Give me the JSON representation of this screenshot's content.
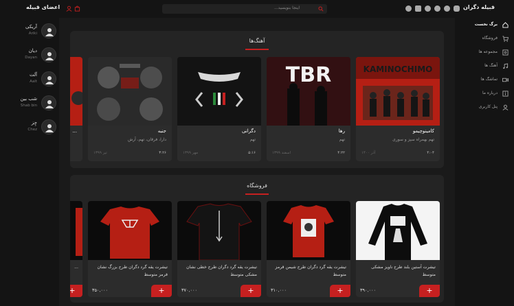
{
  "topbar": {
    "members_title": "اعضای قبیله",
    "search_placeholder": "اینجا بنویسید...",
    "brand": "قبیله دگران"
  },
  "members": [
    {
      "name": "آریکی",
      "sub": "Ariki"
    },
    {
      "name": "دیان",
      "sub": "Dayan"
    },
    {
      "name": "آلت",
      "sub": "Aalt"
    },
    {
      "name": "شب بین",
      "sub": "Shab bin"
    },
    {
      "name": "چِز",
      "sub": "Chez"
    }
  ],
  "nav": [
    {
      "label": "برگ نخست",
      "icon": "home-icon",
      "active": true
    },
    {
      "label": "فروشگاه",
      "icon": "cart-icon"
    },
    {
      "label": "مجموعه ها",
      "icon": "album-icon"
    },
    {
      "label": "آهنگ ها",
      "icon": "music-icon"
    },
    {
      "label": "تماشگ ها",
      "icon": "video-icon"
    },
    {
      "label": "درباره ما",
      "icon": "info-icon"
    },
    {
      "label": "پنل کاربری",
      "icon": "user-icon"
    }
  ],
  "songs_section": {
    "title": "آهنگ‌ها",
    "items": [
      {
        "title": "کامینوچیمو",
        "artist": "تهم بهمراه سپز و سوری",
        "duration": "۴:۰۴",
        "date": "آذر ۱۴۰۰"
      },
      {
        "title": "رها",
        "artist": "تهم",
        "duration": "۴:۲۲",
        "date": "اسفند ۱۳۹۹"
      },
      {
        "title": "دگرانی",
        "artist": "تهم",
        "duration": "۵:۱۶",
        "date": "مهر ۱۳۹۹"
      },
      {
        "title": "جنبه",
        "artist": "دارا، فرقان، تهم، آرش",
        "duration": "۳:۲۶",
        "date": "تیر ۱۳۹۹"
      },
      {
        "title": "...",
        "artist": "",
        "duration": "",
        "date": ""
      }
    ]
  },
  "shop_section": {
    "title": "فروشگاه",
    "items": [
      {
        "title": "تیشرت آستین بلند طرح ناویز مشکی متوسط",
        "price": "۳۹۰,۰۰۰"
      },
      {
        "title": "تیشرت یقه گرد دگران طرح شیمن قرمز متوسط",
        "price": "۳۱۰,۰۰۰"
      },
      {
        "title": "تیشرت یقه گرد دگران طرح خطی نشان مشکی متوسط",
        "price": "۳۷۰,۰۰۰"
      },
      {
        "title": "تیشرت یقه گرد دگران طرح بزرگ نشان قرمز متوسط",
        "price": "۳۵۰,۰۰۰"
      },
      {
        "title": "...",
        "price": ""
      }
    ]
  },
  "colors": {
    "accent": "#c62020",
    "bg": "#1a1a1a",
    "panel": "#242424",
    "card": "#2c2c2c"
  }
}
